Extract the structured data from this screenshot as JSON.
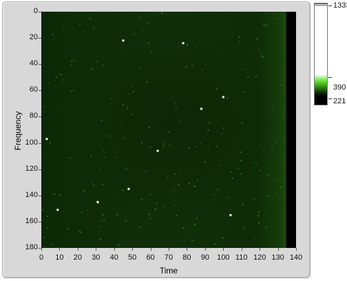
{
  "chart_data": {
    "type": "heatmap",
    "xlabel": "Time",
    "ylabel": "Frequency",
    "xlim": [
      0,
      140
    ],
    "ylim": [
      180,
      0
    ],
    "x_ticks": [
      "0",
      "10",
      "20",
      "30",
      "40",
      "50",
      "60",
      "70",
      "80",
      "90",
      "100",
      "110",
      "120",
      "130",
      "140"
    ],
    "y_ticks": [
      "0",
      "20",
      "40",
      "60",
      "80",
      "100",
      "120",
      "140",
      "160",
      "180"
    ],
    "colorscale": {
      "labels": [
        "1333",
        "390",
        "221"
      ],
      "colors": [
        "#ffffff",
        "#5ee02a",
        "#000000"
      ]
    },
    "bright_points": [
      {
        "x": 45,
        "y": 22
      },
      {
        "x": 78,
        "y": 24
      },
      {
        "x": 100,
        "y": 65
      },
      {
        "x": 88,
        "y": 74
      },
      {
        "x": 3,
        "y": 97
      },
      {
        "x": 64,
        "y": 106
      },
      {
        "x": 48,
        "y": 135
      },
      {
        "x": 9,
        "y": 151
      },
      {
        "x": 31,
        "y": 145
      },
      {
        "x": 104,
        "y": 155
      }
    ]
  }
}
